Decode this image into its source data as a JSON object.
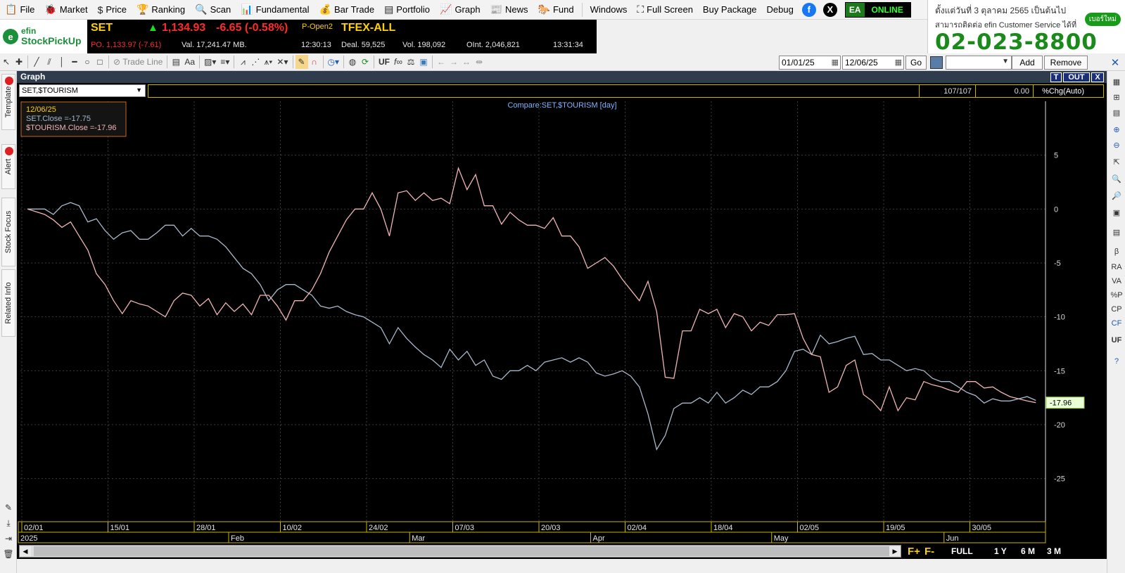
{
  "menu": [
    {
      "icon": "📋",
      "label": "File"
    },
    {
      "icon": "🐞",
      "label": "Market"
    },
    {
      "icon": "$",
      "label": "Price"
    },
    {
      "icon": "🏆",
      "label": "Ranking"
    },
    {
      "icon": "🔍",
      "label": "Scan"
    },
    {
      "icon": "📊",
      "label": "Fundamental"
    },
    {
      "icon": "💰",
      "label": "Bar Trade"
    },
    {
      "icon": "▤",
      "label": "Portfolio"
    },
    {
      "icon": "📈",
      "label": "Graph"
    },
    {
      "icon": "📰",
      "label": "News"
    },
    {
      "icon": "🐎",
      "label": "Fund"
    }
  ],
  "menu_right": {
    "windows": "Windows",
    "full_screen": "Full Screen",
    "buy_package": "Buy Package",
    "debug": "Debug"
  },
  "status_badge": {
    "ea": "EA",
    "online": "ONLINE"
  },
  "banner": {
    "line1": "ตั้งแต่วันที่ 3 ตุลาคม 2565 เป็นต้นไป",
    "line2": "สามารถติดต่อ efin Customer Service ได้ที่",
    "phone": "02-023-8800",
    "button": "เบอร์ใหม่"
  },
  "logo": {
    "line1": "efin",
    "line2": "StockPickUp"
  },
  "ticker": {
    "index": "SET",
    "arrow": "▲",
    "price": "1,134.93",
    "change": "-6.65 (-0.58%)",
    "prev": "PO. 1,133.97 (-7.61)",
    "value": "Val. 17,241.47 MB.",
    "session": "P-Open2",
    "time1": "12:30:13",
    "tfex": "TFEX-ALL",
    "deal": "Deal. 59,525",
    "vol": "Vol. 198,092",
    "oint": "OInt. 2,046,821",
    "time2": "13:31:34"
  },
  "toolbar": {
    "trade_line": "Trade Line",
    "font": "Aa",
    "uf": "UF",
    "date_from": "01/01/25",
    "date_to": "12/06/25",
    "go": "Go",
    "add": "Add",
    "remove": "Remove"
  },
  "left_tabs": [
    "Template",
    "Alert",
    "Stock Focus",
    "Related Info"
  ],
  "right_tools": [
    "RA",
    "VA",
    "%P",
    "CP",
    "CF",
    "UF",
    "β"
  ],
  "graph": {
    "title": "Graph",
    "btn_t": "T",
    "btn_out": "OUT",
    "btn_x": "X",
    "symbol": "SET,$TOURISM",
    "count": "107/107",
    "value": "0.00",
    "mode": "%Chg(Auto)"
  },
  "chart_data": {
    "type": "line",
    "title": "Compare:SET,$TOURISM [day]",
    "tooltip": {
      "date": "12/06/25",
      "set": "SET.Close  =-17.75",
      "tourism": "$TOURISM.Close  =-17.96"
    },
    "last_value_label": "-17.96",
    "ylim": [
      -29,
      10
    ],
    "yticks": [
      5,
      0,
      -5,
      -10,
      -15,
      -20,
      -25
    ],
    "grid": true,
    "x_ticks": [
      "02/01",
      "15/01",
      "28/01",
      "10/02",
      "24/02",
      "07/03",
      "20/03",
      "02/04",
      "18/04",
      "02/05",
      "19/05",
      "30/05"
    ],
    "x_tick_index": [
      0,
      10,
      20,
      30,
      40,
      50,
      60,
      70,
      80,
      90,
      100,
      110
    ],
    "months": [
      "2025",
      "Feb",
      "Mar",
      "Apr",
      "May",
      "Jun"
    ],
    "month_index": [
      0,
      24,
      45,
      66,
      87,
      107
    ],
    "n_points": 118,
    "series": [
      {
        "name": "SET",
        "color": "#a8b8cc",
        "points": [
          [
            0,
            0
          ],
          [
            2,
            0
          ],
          [
            3,
            -0.5
          ],
          [
            4,
            0.3
          ],
          [
            5,
            0.6
          ],
          [
            6,
            0.3
          ],
          [
            7,
            -1.2
          ],
          [
            8,
            -0.9
          ],
          [
            9,
            -2
          ],
          [
            10,
            -2.8
          ],
          [
            11,
            -2.2
          ],
          [
            12,
            -2
          ],
          [
            13,
            -2.8
          ],
          [
            14,
            -2.8
          ],
          [
            15,
            -2.2
          ],
          [
            16,
            -1.5
          ],
          [
            17,
            -1.5
          ],
          [
            18,
            -2.5
          ],
          [
            19,
            -1.8
          ],
          [
            20,
            -2.5
          ],
          [
            21,
            -2.5
          ],
          [
            22,
            -2.8
          ],
          [
            23,
            -3.5
          ],
          [
            24,
            -4.5
          ],
          [
            25,
            -5.5
          ],
          [
            26,
            -6
          ],
          [
            27,
            -7
          ],
          [
            28,
            -8.5
          ],
          [
            29,
            -7.5
          ],
          [
            30,
            -7
          ],
          [
            31,
            -7
          ],
          [
            32,
            -7.5
          ],
          [
            33,
            -8
          ],
          [
            34,
            -9
          ],
          [
            35,
            -9.2
          ],
          [
            36,
            -9
          ],
          [
            37,
            -9.5
          ],
          [
            38,
            -9.8
          ],
          [
            39,
            -10
          ],
          [
            40,
            -10.5
          ],
          [
            41,
            -11
          ],
          [
            42,
            -12.5
          ],
          [
            43,
            -11
          ],
          [
            44,
            -12
          ],
          [
            45,
            -12.8
          ],
          [
            46,
            -13.5
          ],
          [
            47,
            -14
          ],
          [
            48,
            -14.7
          ],
          [
            49,
            -13
          ],
          [
            50,
            -14
          ],
          [
            51,
            -13.2
          ],
          [
            52,
            -14.5
          ],
          [
            53,
            -14
          ],
          [
            54,
            -15.5
          ],
          [
            55,
            -15.8
          ],
          [
            56,
            -15
          ],
          [
            57,
            -15
          ],
          [
            58,
            -14.5
          ],
          [
            59,
            -15
          ],
          [
            60,
            -14.2
          ],
          [
            61,
            -14
          ],
          [
            62,
            -13.8
          ],
          [
            63,
            -14.2
          ],
          [
            64,
            -13.8
          ],
          [
            65,
            -14.2
          ],
          [
            66,
            -15.2
          ],
          [
            67,
            -15.5
          ],
          [
            68,
            -15.3
          ],
          [
            69,
            -15
          ],
          [
            70,
            -15.5
          ],
          [
            71,
            -16.5
          ],
          [
            72,
            -19
          ],
          [
            73,
            -22.3
          ],
          [
            74,
            -21
          ],
          [
            75,
            -18.5
          ],
          [
            76,
            -18
          ],
          [
            77,
            -18
          ],
          [
            78,
            -17.5
          ],
          [
            79,
            -18
          ],
          [
            80,
            -17
          ],
          [
            81,
            -18
          ],
          [
            82,
            -17.5
          ],
          [
            83,
            -16.8
          ],
          [
            84,
            -17.2
          ],
          [
            85,
            -16.5
          ],
          [
            86,
            -16.5
          ],
          [
            87,
            -16
          ],
          [
            88,
            -15
          ],
          [
            89,
            -13.2
          ],
          [
            90,
            -13
          ],
          [
            91,
            -13.5
          ],
          [
            92,
            -11.7
          ],
          [
            93,
            -12.5
          ],
          [
            94,
            -12.3
          ],
          [
            95,
            -12
          ],
          [
            96,
            -11.8
          ],
          [
            97,
            -13.5
          ],
          [
            98,
            -13.4
          ],
          [
            99,
            -14
          ],
          [
            100,
            -14
          ],
          [
            101,
            -14.5
          ],
          [
            102,
            -15
          ],
          [
            103,
            -14.8
          ],
          [
            104,
            -15
          ],
          [
            105,
            -15.7
          ],
          [
            106,
            -16
          ],
          [
            107,
            -16
          ],
          [
            108,
            -16.5
          ],
          [
            109,
            -17
          ],
          [
            110,
            -17.3
          ],
          [
            111,
            -18
          ],
          [
            112,
            -17.6
          ],
          [
            113,
            -17.8
          ],
          [
            114,
            -17.8
          ],
          [
            115,
            -17.6
          ],
          [
            116,
            -17.4
          ],
          [
            117,
            -17.75
          ]
        ]
      },
      {
        "name": "$TOURISM",
        "color": "#f0b4b4",
        "points": [
          [
            0,
            0
          ],
          [
            2,
            -0.5
          ],
          [
            3,
            -1
          ],
          [
            4,
            -1.7
          ],
          [
            5,
            -1.2
          ],
          [
            6,
            -2.5
          ],
          [
            7,
            -3.8
          ],
          [
            8,
            -6
          ],
          [
            9,
            -7
          ],
          [
            10,
            -8.5
          ],
          [
            11,
            -9.7
          ],
          [
            12,
            -8.5
          ],
          [
            13,
            -8.8
          ],
          [
            14,
            -9
          ],
          [
            15,
            -9.5
          ],
          [
            16,
            -10
          ],
          [
            17,
            -8.5
          ],
          [
            18,
            -7.8
          ],
          [
            19,
            -8
          ],
          [
            20,
            -9
          ],
          [
            21,
            -8.3
          ],
          [
            22,
            -9.8
          ],
          [
            23,
            -8.7
          ],
          [
            24,
            -9.5
          ],
          [
            25,
            -8.8
          ],
          [
            26,
            -9.8
          ],
          [
            27,
            -8
          ],
          [
            28,
            -8
          ],
          [
            29,
            -9
          ],
          [
            30,
            -10.3
          ],
          [
            31,
            -8.5
          ],
          [
            32,
            -8.5
          ],
          [
            33,
            -7.5
          ],
          [
            34,
            -6
          ],
          [
            35,
            -4
          ],
          [
            36,
            -2.5
          ],
          [
            37,
            -1
          ],
          [
            38,
            0
          ],
          [
            39,
            0
          ],
          [
            40,
            1.5
          ],
          [
            41,
            0
          ],
          [
            42,
            -2.5
          ],
          [
            43,
            1.5
          ],
          [
            44,
            1.7
          ],
          [
            45,
            0.8
          ],
          [
            46,
            1.5
          ],
          [
            47,
            0.8
          ],
          [
            48,
            1
          ],
          [
            49,
            0.5
          ],
          [
            50,
            3.8
          ],
          [
            51,
            1.8
          ],
          [
            52,
            3.2
          ],
          [
            53,
            0.3
          ],
          [
            54,
            0.3
          ],
          [
            55,
            -1.4
          ],
          [
            56,
            -0.3
          ],
          [
            57,
            -1
          ],
          [
            58,
            -1.5
          ],
          [
            59,
            -1.5
          ],
          [
            60,
            -1.8
          ],
          [
            61,
            -0.8
          ],
          [
            62,
            -2.5
          ],
          [
            63,
            -2.5
          ],
          [
            64,
            -3.5
          ],
          [
            65,
            -5.5
          ],
          [
            66,
            -5
          ],
          [
            67,
            -4.5
          ],
          [
            68,
            -5.3
          ],
          [
            69,
            -6.5
          ],
          [
            70,
            -7.5
          ],
          [
            71,
            -8.5
          ],
          [
            72,
            -6.7
          ],
          [
            73,
            -9.5
          ],
          [
            74,
            -15.6
          ],
          [
            75,
            -15.7
          ],
          [
            76,
            -11.3
          ],
          [
            77,
            -11.3
          ],
          [
            78,
            -9.3
          ],
          [
            79,
            -9.7
          ],
          [
            80,
            -9.3
          ],
          [
            81,
            -11
          ],
          [
            82,
            -9.7
          ],
          [
            83,
            -10
          ],
          [
            84,
            -11.3
          ],
          [
            85,
            -10.5
          ],
          [
            86,
            -10.8
          ],
          [
            87,
            -9.8
          ],
          [
            88,
            -9.8
          ],
          [
            89,
            -9.7
          ],
          [
            90,
            -12
          ],
          [
            91,
            -13.5
          ],
          [
            92,
            -13.7
          ],
          [
            93,
            -17
          ],
          [
            94,
            -16.5
          ],
          [
            95,
            -14.5
          ],
          [
            96,
            -14
          ],
          [
            97,
            -17.2
          ],
          [
            98,
            -17.8
          ],
          [
            99,
            -18.7
          ],
          [
            100,
            -16.5
          ],
          [
            101,
            -18.7
          ],
          [
            102,
            -17.5
          ],
          [
            103,
            -17.7
          ],
          [
            104,
            -16
          ],
          [
            105,
            -16.3
          ],
          [
            106,
            -16.5
          ],
          [
            107,
            -16.8
          ],
          [
            108,
            -17
          ],
          [
            109,
            -16
          ],
          [
            110,
            -16
          ],
          [
            111,
            -16.6
          ],
          [
            112,
            -16.5
          ],
          [
            113,
            -17
          ],
          [
            114,
            -17.4
          ],
          [
            115,
            -17.6
          ],
          [
            116,
            -17.8
          ],
          [
            117,
            -17.96
          ]
        ]
      }
    ]
  },
  "range_buttons": [
    "F+",
    "F-",
    "FULL",
    "1 Y",
    "6 M",
    "3 M"
  ]
}
